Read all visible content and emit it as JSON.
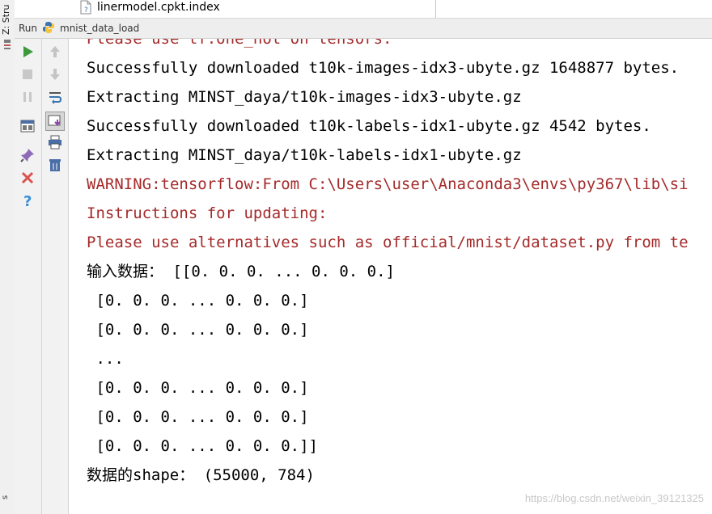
{
  "structure_panel": {
    "label": "Z: Stru",
    "bottom_label": "s"
  },
  "file_tab": {
    "name": "linermodel.cpkt.index"
  },
  "run_panel": {
    "label": "Run",
    "config_name": "mnist_data_load"
  },
  "toolbar_left": [
    "run-icon",
    "stop-icon",
    "pause-icon",
    "layout-icon",
    "pin-icon",
    "close-icon",
    "help-icon"
  ],
  "toolbar_right": [
    "up-arrow-icon",
    "down-arrow-icon",
    "soft-wrap-icon",
    "scroll-to-end-icon",
    "print-icon",
    "trash-icon"
  ],
  "console": {
    "lines": [
      {
        "text": "Please use tf.one_hot on tensors.",
        "style": "error"
      },
      {
        "text": "Successfully downloaded t10k-images-idx3-ubyte.gz 1648877 bytes.",
        "style": "normal"
      },
      {
        "text": "Extracting MINST_daya/t10k-images-idx3-ubyte.gz",
        "style": "normal"
      },
      {
        "text": "Successfully downloaded t10k-labels-idx1-ubyte.gz 4542 bytes.",
        "style": "normal"
      },
      {
        "text": "Extracting MINST_daya/t10k-labels-idx1-ubyte.gz",
        "style": "normal"
      },
      {
        "text": "WARNING:tensorflow:From C:\\Users\\user\\Anaconda3\\envs\\py367\\lib\\si",
        "style": "error"
      },
      {
        "text": "Instructions for updating:",
        "style": "error"
      },
      {
        "text": "Please use alternatives such as official/mnist/dataset.py from te",
        "style": "error"
      },
      {
        "text": "输入数据： [[0. 0. 0. ... 0. 0. 0.]",
        "style": "normal"
      },
      {
        "text": " [0. 0. 0. ... 0. 0. 0.]",
        "style": "normal"
      },
      {
        "text": " [0. 0. 0. ... 0. 0. 0.]",
        "style": "normal"
      },
      {
        "text": " ...",
        "style": "normal"
      },
      {
        "text": " [0. 0. 0. ... 0. 0. 0.]",
        "style": "normal"
      },
      {
        "text": " [0. 0. 0. ... 0. 0. 0.]",
        "style": "normal"
      },
      {
        "text": " [0. 0. 0. ... 0. 0. 0.]]",
        "style": "normal"
      },
      {
        "text": "数据的shape： (55000, 784)",
        "style": "normal"
      }
    ]
  },
  "watermark": "https://blog.csdn.net/weixin_39121325",
  "colors": {
    "error_text": "#a52a2a",
    "normal_text": "#000000",
    "run_green": "#3c9a3c"
  }
}
